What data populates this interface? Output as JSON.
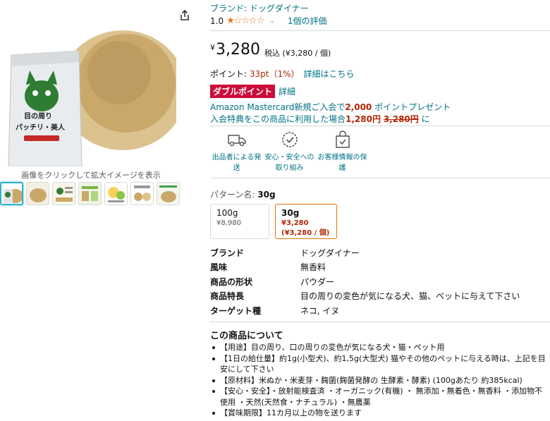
{
  "gallery": {
    "caption": "画像をクリックして拡大イメージを表示",
    "package_text_1": "目の周り",
    "package_text_2": "パッチリ・美人",
    "thumbnail_count": 7
  },
  "product": {
    "brand_link": "ブランド: ドッグダイナー",
    "rating_value": "1.0",
    "rating_stars": "★☆☆☆☆",
    "rating_count": "1個の評価",
    "price_symbol": "¥",
    "price_amount": "3,280",
    "price_tax": "税込 (¥3,280 / 個)",
    "points_label": "ポイント: ",
    "points_value": "33pt（1%）",
    "points_link": "詳細はこちら",
    "double_badge": "ダブルポイント",
    "double_link": "詳細",
    "promo1_pre": "Amazon Mastercard新規ご入会で",
    "promo1_points": "2,000",
    "promo1_post": " ポイントプレゼント",
    "promo2_pre": "入会特典をこの商品に利用した場合",
    "promo2_price": "1,280円",
    "promo2_old": "3,280円",
    "promo2_post": " に"
  },
  "features": [
    {
      "icon": "truck-icon",
      "label": "出品者による発送"
    },
    {
      "icon": "shield-check-icon",
      "label": "安心・安全への取り組み"
    },
    {
      "icon": "lock-bag-icon",
      "label": "お客様情報の保護"
    }
  ],
  "pattern": {
    "label": "パターン名: ",
    "selected": "30g",
    "options": [
      {
        "name": "100g",
        "price": "¥8,980",
        "unit": ""
      },
      {
        "name": "30g",
        "price": "¥3,280",
        "unit": "(¥3,280 / 個)"
      }
    ]
  },
  "specs": [
    {
      "key": "ブランド",
      "value": "ドッグダイナー"
    },
    {
      "key": "風味",
      "value": "無香料"
    },
    {
      "key": "商品の形状",
      "value": "パウダー"
    },
    {
      "key": "商品特長",
      "value": "目の周りの変色が気になる犬、猫、ペットに与えて下さい"
    },
    {
      "key": "ターゲット種",
      "value": "ネコ, イヌ"
    }
  ],
  "about": {
    "title": "この商品について",
    "items": [
      "【用途】目の周り、口の周りの変色が気になる犬・猫・ペット用",
      "【1日の給仕量】約1g(小型犬)、約1,5g(大型犬) 猫やその他のペットに与える時は、上記を目安にして下さい",
      "【原材料】米ぬか・米麦芽・麹菌(麹菌発酵の 生酵素・酵素) (100gあたり 約385kcal)",
      "【安心・安全】・放射能検査済 ・オーガニック(有機) ・ 無添加・無着色・無香料 ・添加物不使用 ・天然(天然食・ナチュラル) ・無農薬",
      "【賞味期限】11カ月以上の物を送ります"
    ]
  },
  "colors": {
    "link": "#007185",
    "price_red": "#b12704",
    "badge_red": "#cc0c39",
    "star": "#de7921"
  }
}
